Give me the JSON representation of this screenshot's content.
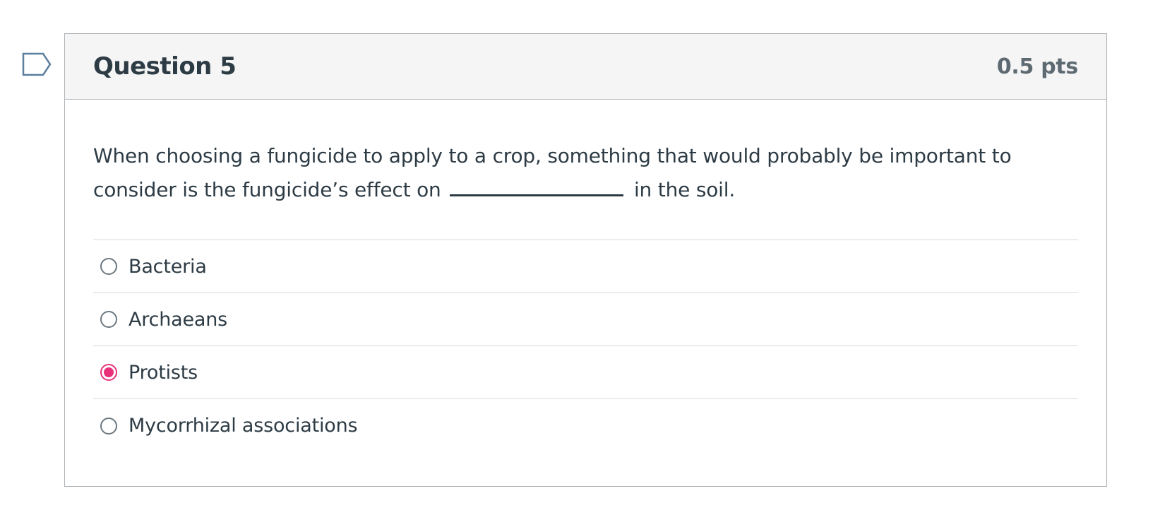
{
  "question": {
    "title": "Question 5",
    "points": "0.5 pts",
    "text_before": "When choosing a fungicide to apply to a crop, something that would probably be important to consider is the fungicide’s effect on",
    "text_after": "in the soil.",
    "answers": [
      {
        "label": "Bacteria",
        "selected": false
      },
      {
        "label": "Archaeans",
        "selected": false
      },
      {
        "label": "Protists",
        "selected": true
      },
      {
        "label": "Mycorrhizal associations",
        "selected": false
      }
    ]
  },
  "icons": {
    "flag": "bookmark-flag-icon"
  },
  "colors": {
    "selected_radio": "#e8317a",
    "flag_outline": "#5b7f9e",
    "text": "#2d3b45",
    "header_bg": "#f5f5f5"
  }
}
